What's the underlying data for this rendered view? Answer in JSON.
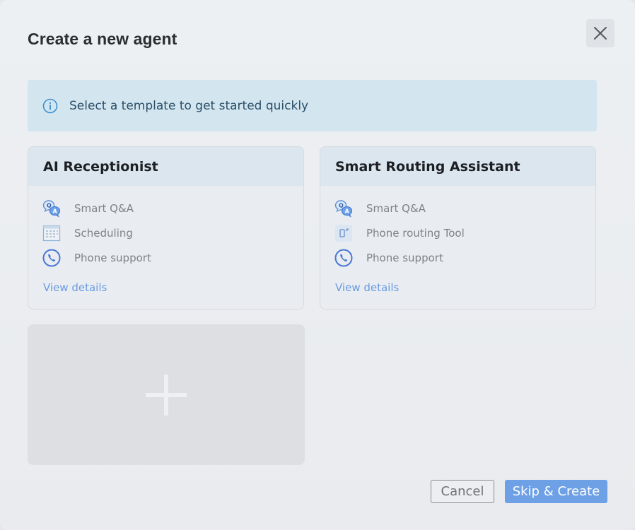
{
  "dialog": {
    "title": "Create a new agent",
    "close_icon": "close-icon"
  },
  "banner": {
    "icon": "info-icon",
    "text": "Select a template to get started quickly"
  },
  "templates": [
    {
      "title": "AI Receptionist",
      "features": [
        {
          "icon": "qa-chat-icon",
          "label": "Smart Q&A"
        },
        {
          "icon": "calendar-icon",
          "label": "Scheduling"
        },
        {
          "icon": "phone-icon",
          "label": "Phone support"
        }
      ],
      "link": "View details"
    },
    {
      "title": "Smart Routing Assistant",
      "features": [
        {
          "icon": "qa-chat-icon",
          "label": "Smart Q&A"
        },
        {
          "icon": "phone-routing-icon",
          "label": "Phone routing Tool"
        },
        {
          "icon": "phone-icon",
          "label": "Phone support"
        }
      ],
      "link": "View details"
    }
  ],
  "add_template": {
    "icon": "plus-icon"
  },
  "footer": {
    "cancel_label": "Cancel",
    "create_label": "Skip & Create"
  },
  "colors": {
    "accent": "#6ea0e6",
    "banner_bg": "#d3e6f0",
    "link": "#6a9ae0"
  }
}
